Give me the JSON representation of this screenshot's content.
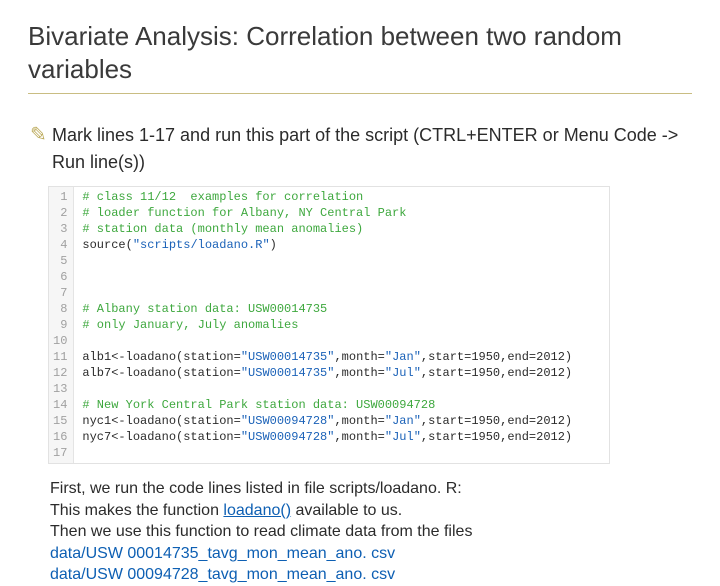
{
  "header": {
    "title": "Bivariate Analysis: Correlation between two random variables"
  },
  "bullet": {
    "icon_glyph": "✎",
    "text": "Mark lines 1-17 and run this part of the script (CTRL+ENTER or Menu Code -> Run line(s))"
  },
  "code": {
    "line_numbers": [
      "1",
      "2",
      "3",
      "4",
      "5",
      "6",
      "7",
      "8",
      "9",
      "10",
      "11",
      "12",
      "13",
      "14",
      "15",
      "16",
      "17"
    ],
    "lines": [
      {
        "cls": "c-comment",
        "text": "# class 11/12  examples for correlation"
      },
      {
        "cls": "c-comment",
        "text": "# loader function for Albany, NY Central Park"
      },
      {
        "cls": "c-comment",
        "text": "# station data (monthly mean anomalies)"
      },
      {
        "cls": "c-call",
        "segments": [
          {
            "t": "source(",
            "c": "c-call"
          },
          {
            "t": "\"scripts/loadano.R\"",
            "c": "c-string"
          },
          {
            "t": ")",
            "c": "c-call"
          }
        ]
      },
      {
        "cls": "c-call",
        "text": ""
      },
      {
        "cls": "c-call",
        "text": ""
      },
      {
        "cls": "c-call",
        "text": ""
      },
      {
        "cls": "c-comment",
        "text": "# Albany station data: USW00014735"
      },
      {
        "cls": "c-comment",
        "text": "# only January, July anomalies"
      },
      {
        "cls": "c-call",
        "text": ""
      },
      {
        "cls": "c-call",
        "segments": [
          {
            "t": "alb1<-loadano(station=",
            "c": "c-assign"
          },
          {
            "t": "\"USW00014735\"",
            "c": "c-string"
          },
          {
            "t": ",month=",
            "c": "c-assign"
          },
          {
            "t": "\"Jan\"",
            "c": "c-string"
          },
          {
            "t": ",start=1950,end=2012)",
            "c": "c-assign"
          }
        ]
      },
      {
        "cls": "c-call",
        "segments": [
          {
            "t": "alb7<-loadano(station=",
            "c": "c-assign"
          },
          {
            "t": "\"USW00014735\"",
            "c": "c-string"
          },
          {
            "t": ",month=",
            "c": "c-assign"
          },
          {
            "t": "\"Jul\"",
            "c": "c-string"
          },
          {
            "t": ",start=1950,end=2012)",
            "c": "c-assign"
          }
        ]
      },
      {
        "cls": "c-call",
        "text": ""
      },
      {
        "cls": "c-comment",
        "text": "# New York Central Park station data: USW00094728"
      },
      {
        "cls": "c-call",
        "segments": [
          {
            "t": "nyc1<-loadano(station=",
            "c": "c-assign"
          },
          {
            "t": "\"USW00094728\"",
            "c": "c-string"
          },
          {
            "t": ",month=",
            "c": "c-assign"
          },
          {
            "t": "\"Jan\"",
            "c": "c-string"
          },
          {
            "t": ",start=1950,end=2012)",
            "c": "c-assign"
          }
        ]
      },
      {
        "cls": "c-call",
        "segments": [
          {
            "t": "nyc7<-loadano(station=",
            "c": "c-assign"
          },
          {
            "t": "\"USW00094728\"",
            "c": "c-string"
          },
          {
            "t": ",month=",
            "c": "c-assign"
          },
          {
            "t": "\"Jul\"",
            "c": "c-string"
          },
          {
            "t": ",start=1950,end=2012)",
            "c": "c-assign"
          }
        ]
      },
      {
        "cls": "c-call",
        "text": ""
      }
    ]
  },
  "footer": {
    "p1_a": "First, we run the code lines listed in file scripts/loadano. R:",
    "p1_b": "This makes the function ",
    "p1_link": "loadano()",
    "p1_c": " available to us.",
    "p2": "Then we use this function to read climate data from the files",
    "file1": "data/USW 00014735_tavg_mon_mean_ano. csv",
    "file2": "data/USW 00094728_tavg_mon_mean_ano. csv"
  }
}
